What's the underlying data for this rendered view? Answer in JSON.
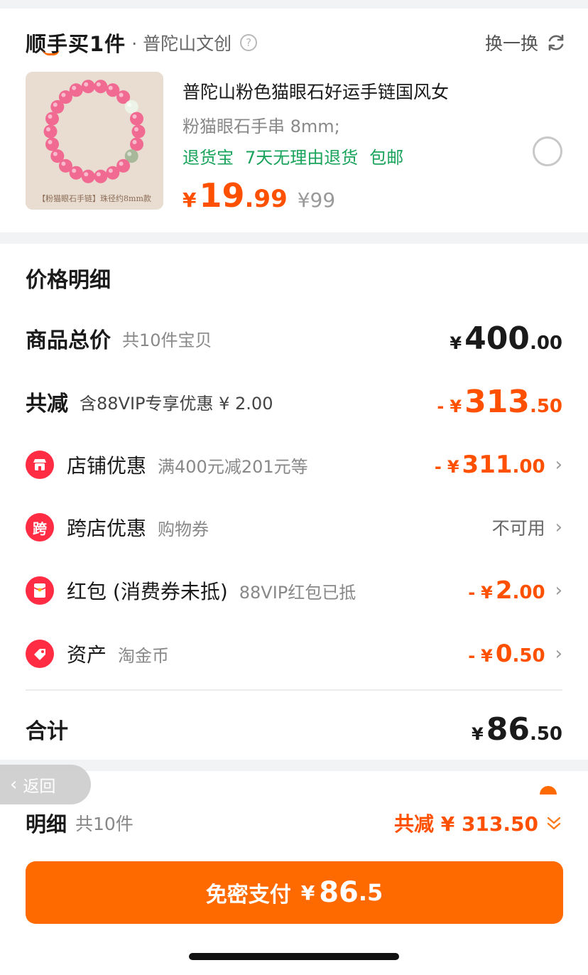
{
  "header": {
    "brand": "顺手买1件",
    "dot": "·",
    "sub": "普陀山文创",
    "help": "?",
    "swap_label": "换一换"
  },
  "product": {
    "title": "普陀山粉色猫眼石好运手链国风女",
    "spec": "粉猫眼石手串 8mm;",
    "tags": [
      "退货宝",
      "7天无理由退货",
      "包邮"
    ],
    "price_yen": "¥",
    "price_int": "19",
    "price_dec": ".99",
    "original_price": "¥99",
    "image_caption": "【粉猫眼石手链】珠径约8mm款"
  },
  "price_detail": {
    "title": "价格明细",
    "goods_total": {
      "label": "商品总价",
      "sub": "共10件宝贝",
      "yen": "¥",
      "int": "400",
      "dec": ".00"
    },
    "total_discount": {
      "label": "共减",
      "sub": "含88VIP专享优惠 ¥ 2.00",
      "prefix": "-",
      "yen": "¥",
      "int": "313",
      "dec": ".50"
    },
    "store_discount": {
      "label": "店铺优惠",
      "sub": "满400元减201元等",
      "prefix": "-",
      "yen": "¥",
      "int": "311",
      "dec": ".00",
      "icon": "store-icon"
    },
    "cross_store": {
      "label": "跨店优惠",
      "sub": "购物券",
      "value": "不可用",
      "icon": "cross-store-icon",
      "icon_text": "跨"
    },
    "red_packet": {
      "label": "红包 (消费券未抵)",
      "sub": "88VIP红包已抵",
      "prefix": "-",
      "yen": "¥",
      "int": "2",
      "dec": ".00",
      "icon": "red-packet-icon"
    },
    "assets": {
      "label": "资产",
      "sub": "淘金币",
      "prefix": "-",
      "yen": "¥",
      "int": "0",
      "dec": ".50",
      "icon": "coin-tag-icon"
    },
    "total": {
      "label": "合计",
      "yen": "¥",
      "int": "86",
      "dec": ".50"
    }
  },
  "back_button": {
    "label": "返回"
  },
  "bottom": {
    "detail_label": "明细",
    "detail_count": "共10件",
    "discount_label": "共减 ¥ 313.50",
    "pay_label": "免密支付",
    "pay_yen": "¥",
    "pay_int": "86",
    "pay_dec": ".5"
  },
  "colors": {
    "accent": "#ff6a00",
    "price_orange": "#ff5000",
    "green_tag": "#19a35b",
    "red_icon": "#ff2c43"
  }
}
